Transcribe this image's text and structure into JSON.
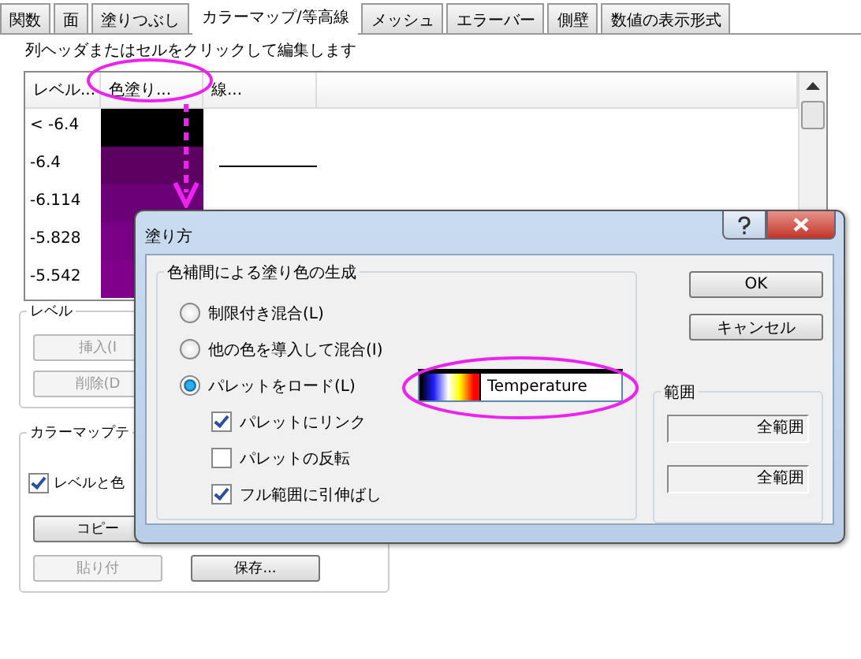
{
  "tabs": [
    {
      "label": "関数",
      "selected": false
    },
    {
      "label": "面",
      "selected": false
    },
    {
      "label": "塗りつぶし",
      "selected": false
    },
    {
      "label": "カラーマップ/等高線",
      "selected": true
    },
    {
      "label": "メッシュ",
      "selected": false
    },
    {
      "label": "エラーバー",
      "selected": false
    },
    {
      "label": "側壁",
      "selected": false
    },
    {
      "label": "数値の表示形式",
      "selected": false
    }
  ],
  "hint": "列ヘッダまたはセルをクリックして編集します",
  "table": {
    "columns": [
      "レベル...",
      "色塗り...",
      "線..."
    ],
    "rows": [
      {
        "level": "< -6.4",
        "color": "#000000",
        "line": false
      },
      {
        "level": "-6.4",
        "color": "#5c0062",
        "line": true
      },
      {
        "level": "-6.114",
        "color": "#6c0078",
        "line": false
      },
      {
        "level": "-5.828",
        "color": "#780084",
        "line": false
      },
      {
        "level": "-5.542",
        "color": "#80008c",
        "line": false
      }
    ]
  },
  "level_group": {
    "title": "レベル",
    "buttons": [
      {
        "label": "挿入(I",
        "disabled": true
      },
      {
        "label": "削除(D",
        "disabled": true
      }
    ]
  },
  "colormap_group": {
    "title": "カラーマップテ",
    "checkbox": {
      "label": "レベルと色",
      "checked": true
    },
    "buttons": [
      {
        "label": "コピー",
        "disabled": false
      },
      {
        "label": "貼り付",
        "disabled": true
      },
      {
        "label": "保存...",
        "disabled": false
      }
    ]
  },
  "dialog": {
    "title": "塗り方",
    "group_title": "色補間による塗り色の生成",
    "options": [
      {
        "label": "制限付き混合(L)",
        "selected": false
      },
      {
        "label": "他の色を導入して混合(I)",
        "selected": false
      },
      {
        "label": "パレットをロード(L)",
        "selected": true
      }
    ],
    "palette": "Temperature",
    "checkboxes": [
      {
        "label": "パレットにリンク",
        "checked": true
      },
      {
        "label": "パレットの反転",
        "checked": false
      },
      {
        "label": "フル範囲に引伸ばし",
        "checked": true
      }
    ],
    "buttons": [
      "OK",
      "キャンセル"
    ],
    "range": {
      "title": "範囲",
      "fields": [
        "全範囲",
        "全範囲"
      ]
    }
  }
}
